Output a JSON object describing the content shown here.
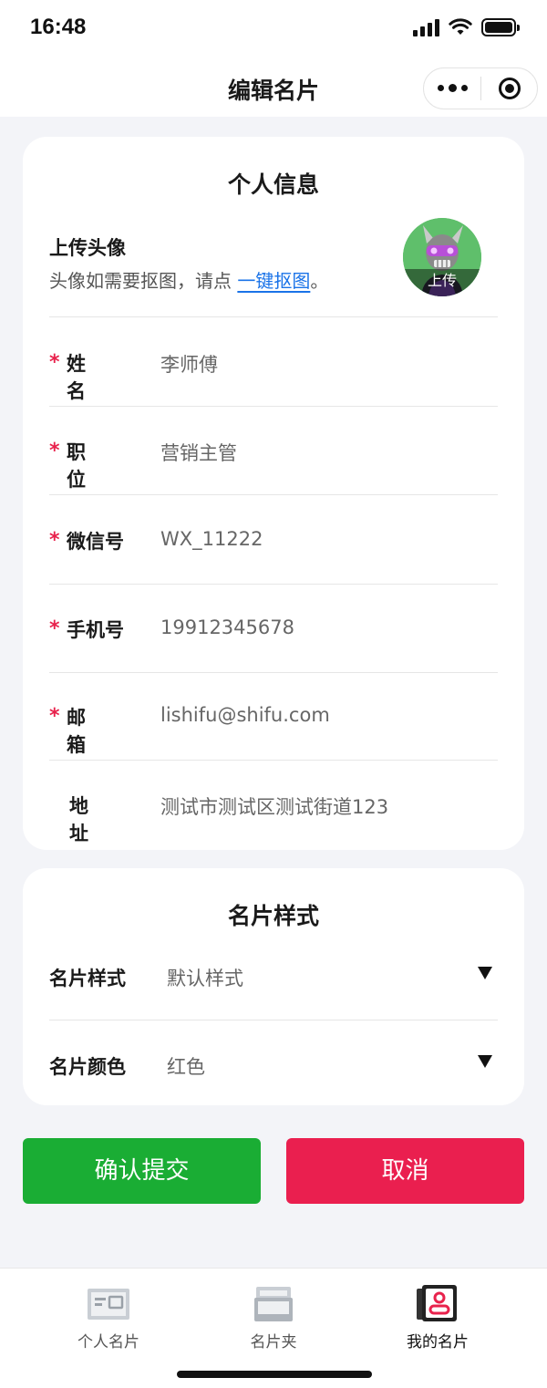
{
  "status_bar": {
    "time": "16:48"
  },
  "nav": {
    "title": "编辑名片"
  },
  "personal_card": {
    "title": "个人信息",
    "avatar": {
      "label": "上传头像",
      "hint_prefix": "头像如需要抠图，请点 ",
      "hint_link": "一键抠图",
      "hint_suffix": "。",
      "upload_label": "上传"
    },
    "fields": [
      {
        "label": "姓名",
        "value": "李师傅",
        "required": true
      },
      {
        "label": "职位",
        "value": "营销主管",
        "required": true
      },
      {
        "label": "微信号",
        "value": "WX_11222",
        "required": true
      },
      {
        "label": "手机号",
        "value": "19912345678",
        "required": true
      },
      {
        "label": "邮箱",
        "value": "lishifu@shifu.com",
        "required": true
      },
      {
        "label": "地址",
        "value": "测试市测试区测试街道123",
        "required": false
      }
    ],
    "required_mark": "*"
  },
  "style_card": {
    "title": "名片样式",
    "selects": [
      {
        "label": "名片样式",
        "value": "默认样式"
      },
      {
        "label": "名片颜色",
        "value": "红色"
      }
    ]
  },
  "buttons": {
    "confirm": "确认提交",
    "cancel": "取消"
  },
  "colors": {
    "confirm": "#1aad34",
    "cancel": "#ea1f4f",
    "link": "#1a73e8",
    "required": "#e8224c"
  },
  "tabs": [
    {
      "label": "个人名片",
      "icon": "business-card-icon",
      "active": false
    },
    {
      "label": "名片夹",
      "icon": "card-holder-icon",
      "active": false
    },
    {
      "label": "我的名片",
      "icon": "my-card-icon",
      "active": true
    }
  ]
}
